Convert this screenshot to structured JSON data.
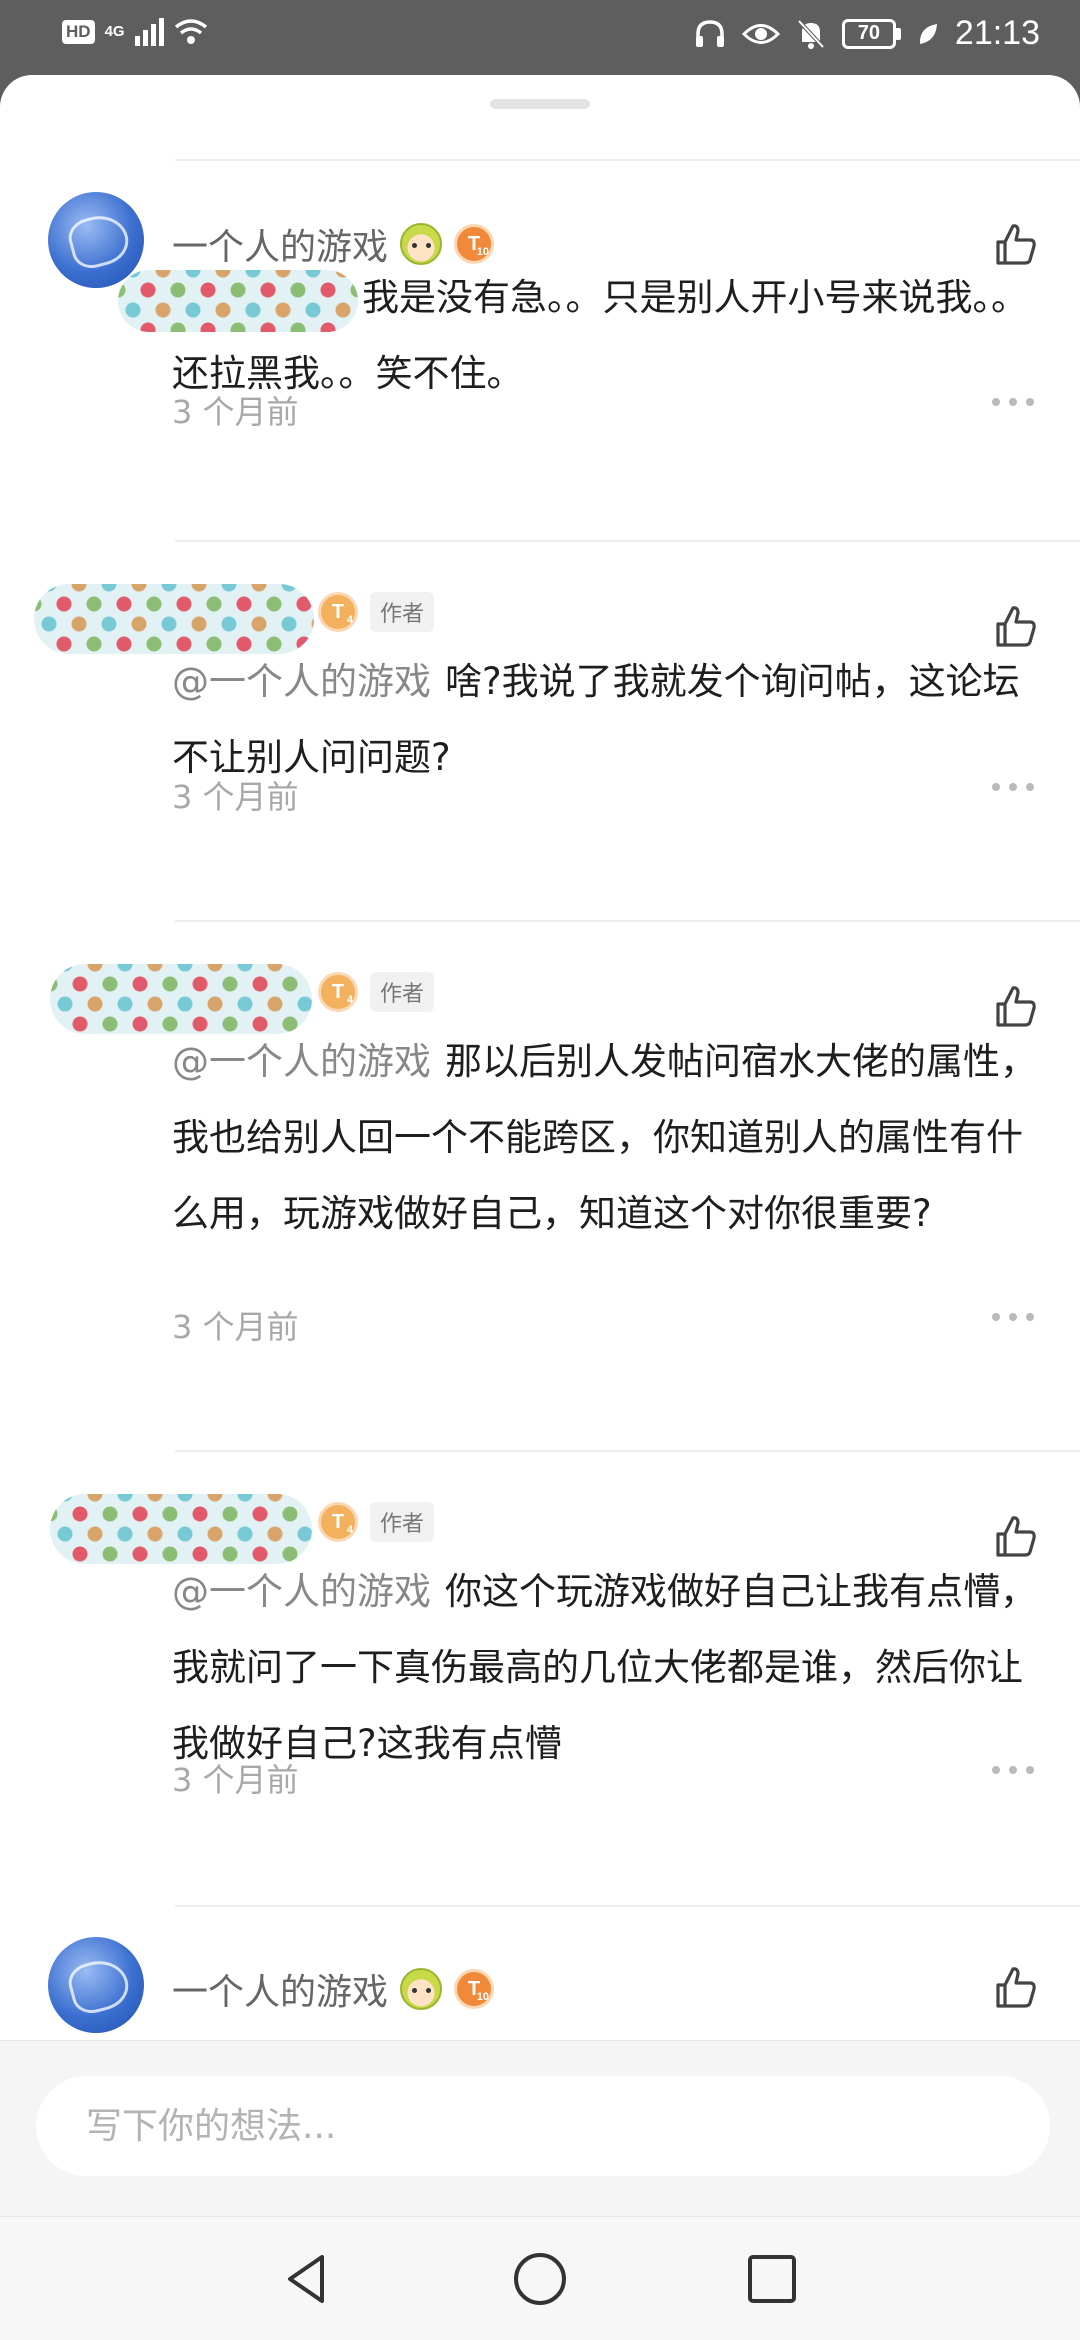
{
  "status_bar": {
    "hd": "HD",
    "network": "4G",
    "battery": "70",
    "time": "21:13"
  },
  "comments": [
    {
      "name": "一个人的游戏",
      "level": "T",
      "level_sub": "10",
      "author_tag": "",
      "mention": "",
      "text": "我是没有急。。只是别人开小号来说我。。还拉黑我。。笑不住。",
      "time": "3 个月前"
    },
    {
      "name": "",
      "level": "T",
      "level_sub": "4",
      "author_tag": "作者",
      "mention": "@一个人的游戏",
      "text": "啥?我说了我就发个询问帖，这论坛不让别人问问题?",
      "time": "3 个月前"
    },
    {
      "name": "",
      "level": "T",
      "level_sub": "4",
      "author_tag": "作者",
      "mention": "@一个人的游戏",
      "text": "那以后别人发帖问宿水大佬的属性，我也给别人回一个不能跨区，你知道别人的属性有什么用，玩游戏做好自己，知道这个对你很重要?",
      "time": "3 个月前"
    },
    {
      "name": "",
      "level": "T",
      "level_sub": "4",
      "author_tag": "作者",
      "mention": "@一个人的游戏",
      "text": "你这个玩游戏做好自己让我有点懵，我就问了一下真伤最高的几位大佬都是谁，然后你让我做好自己?这我有点懵",
      "time": "3 个月前"
    },
    {
      "name": "一个人的游戏",
      "level": "T",
      "level_sub": "10"
    }
  ],
  "input": {
    "placeholder": "写下你的想法..."
  },
  "icons": {
    "like": "thumbs-up-icon",
    "more": "more-dots-icon",
    "back": "back-triangle-icon",
    "home": "home-circle-icon",
    "recents": "recents-square-icon"
  }
}
